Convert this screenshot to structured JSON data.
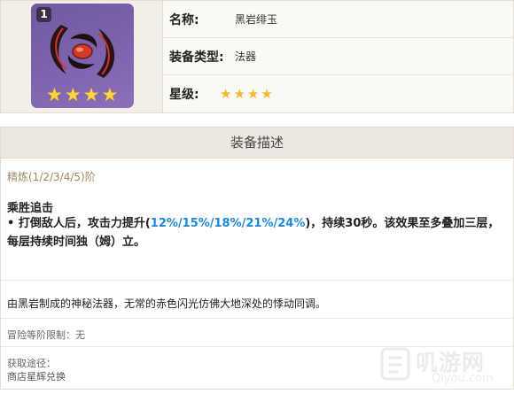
{
  "item": {
    "refine_badge": "1",
    "icon": "obsidian-catalyst-icon",
    "icon_stars": [
      "★",
      "★",
      "★",
      "★"
    ]
  },
  "info": {
    "name_label": "名称:",
    "name_value": "黑岩绯玉",
    "type_label": "装备类型:",
    "type_value": "法器",
    "rarity_label": "星级:",
    "rarity_stars": [
      "★",
      "★",
      "★",
      "★"
    ]
  },
  "desc": {
    "header": "装备描述",
    "refine_line": "精炼(1/2/3/4/5)阶",
    "skill_name": "乘胜追击",
    "skill_prefix": "• 打倒敌人后，攻击力提升(",
    "skill_values": "12%/15%/18%/21%/24%",
    "skill_suffix": ")，持续30秒。该效果至多叠加三层，每层持续时间独（姆）立。",
    "lore": "由黑岩制成的神秘法器，无常的赤色闪光仿佛大地深处的悸动同调。",
    "limit": "冒险等阶限制：无",
    "source_label": "获取途径：",
    "source_value": "商店星辉兑换"
  },
  "watermark": {
    "main": "叽游网",
    "sub": "Qiyou.com"
  },
  "colors": {
    "highlight": "#1c88d8",
    "star": "#f5b82e",
    "icon_bg": "#7d64ae"
  }
}
